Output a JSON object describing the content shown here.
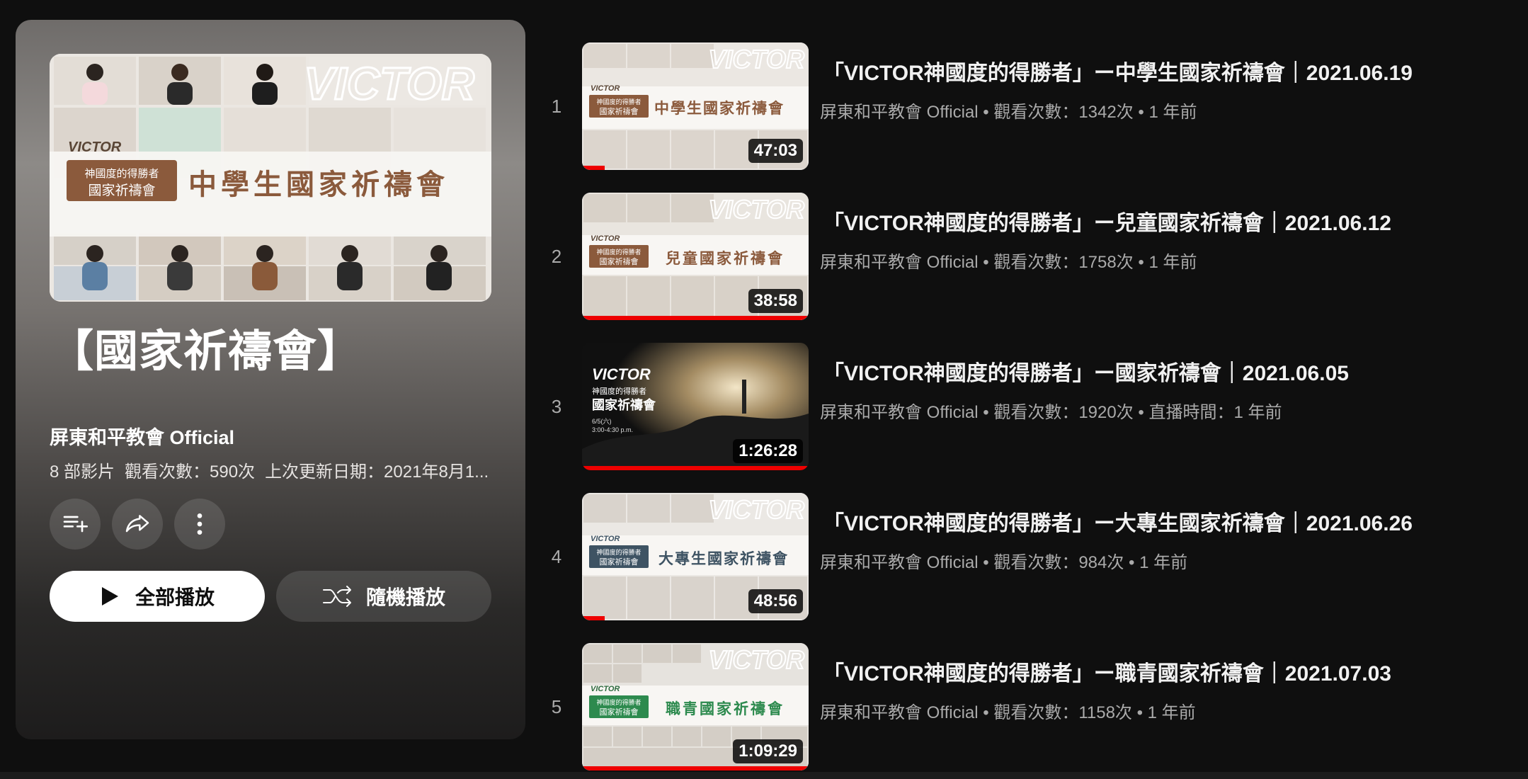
{
  "playlist": {
    "title": "【國家祈禱會】",
    "channel": "屏東和平教會 Official",
    "video_count": "8 部影片",
    "views": "觀看次數：590次",
    "updated": "上次更新日期：2021年8月1...",
    "play_all_label": "全部播放",
    "shuffle_label": "隨機播放",
    "hero_logo": "VICTOR",
    "hero_banner_small_1": "神國度的得勝者",
    "hero_banner_small_2": "國家祈禱會",
    "hero_banner_big": "中學生國家祈禱會"
  },
  "videos": [
    {
      "index": "1",
      "title": "「VICTOR神國度的得勝者」ー中學生國家祈禱會｜2021.06.19",
      "meta": "屏東和平教會 Official • 觀看次數：1342次 • 1 年前",
      "duration": "47:03",
      "banner": "中學生國家祈禱會",
      "progress": 0.1,
      "accent": "#8b5a3c"
    },
    {
      "index": "2",
      "title": "「VICTOR神國度的得勝者」ー兒童國家祈禱會｜2021.06.12",
      "meta": "屏東和平教會 Official • 觀看次數：1758次 • 1 年前",
      "duration": "38:58",
      "banner": "兒童國家祈禱會",
      "progress": 1.0,
      "accent": "#8b5a3c"
    },
    {
      "index": "3",
      "title": "「VICTOR神國度的得勝者」ー國家祈禱會｜2021.06.05",
      "meta": "屏東和平教會 Official • 觀看次數：1920次 • 直播時間：1 年前",
      "duration": "1:26:28",
      "banner": "國家祈禱會",
      "progress": 1.0,
      "accent": "#1a1a1a"
    },
    {
      "index": "4",
      "title": "「VICTOR神國度的得勝者」ー大專生國家祈禱會｜2021.06.26",
      "meta": "屏東和平教會 Official • 觀看次數：984次 • 1 年前",
      "duration": "48:56",
      "banner": "大專生國家祈禱會",
      "progress": 0.1,
      "accent": "#3e5363"
    },
    {
      "index": "5",
      "title": "「VICTOR神國度的得勝者」ー職青國家祈禱會｜2021.07.03",
      "meta": "屏東和平教會 Official • 觀看次數：1158次 • 1 年前",
      "duration": "1:09:29",
      "banner": "職青國家祈禱會",
      "progress": 1.0,
      "accent": "#2d8a4e"
    }
  ],
  "icons": {
    "save": "playlist-add-icon",
    "share": "share-icon",
    "more": "more-vert-icon",
    "play": "play-icon",
    "shuffle": "shuffle-icon"
  }
}
